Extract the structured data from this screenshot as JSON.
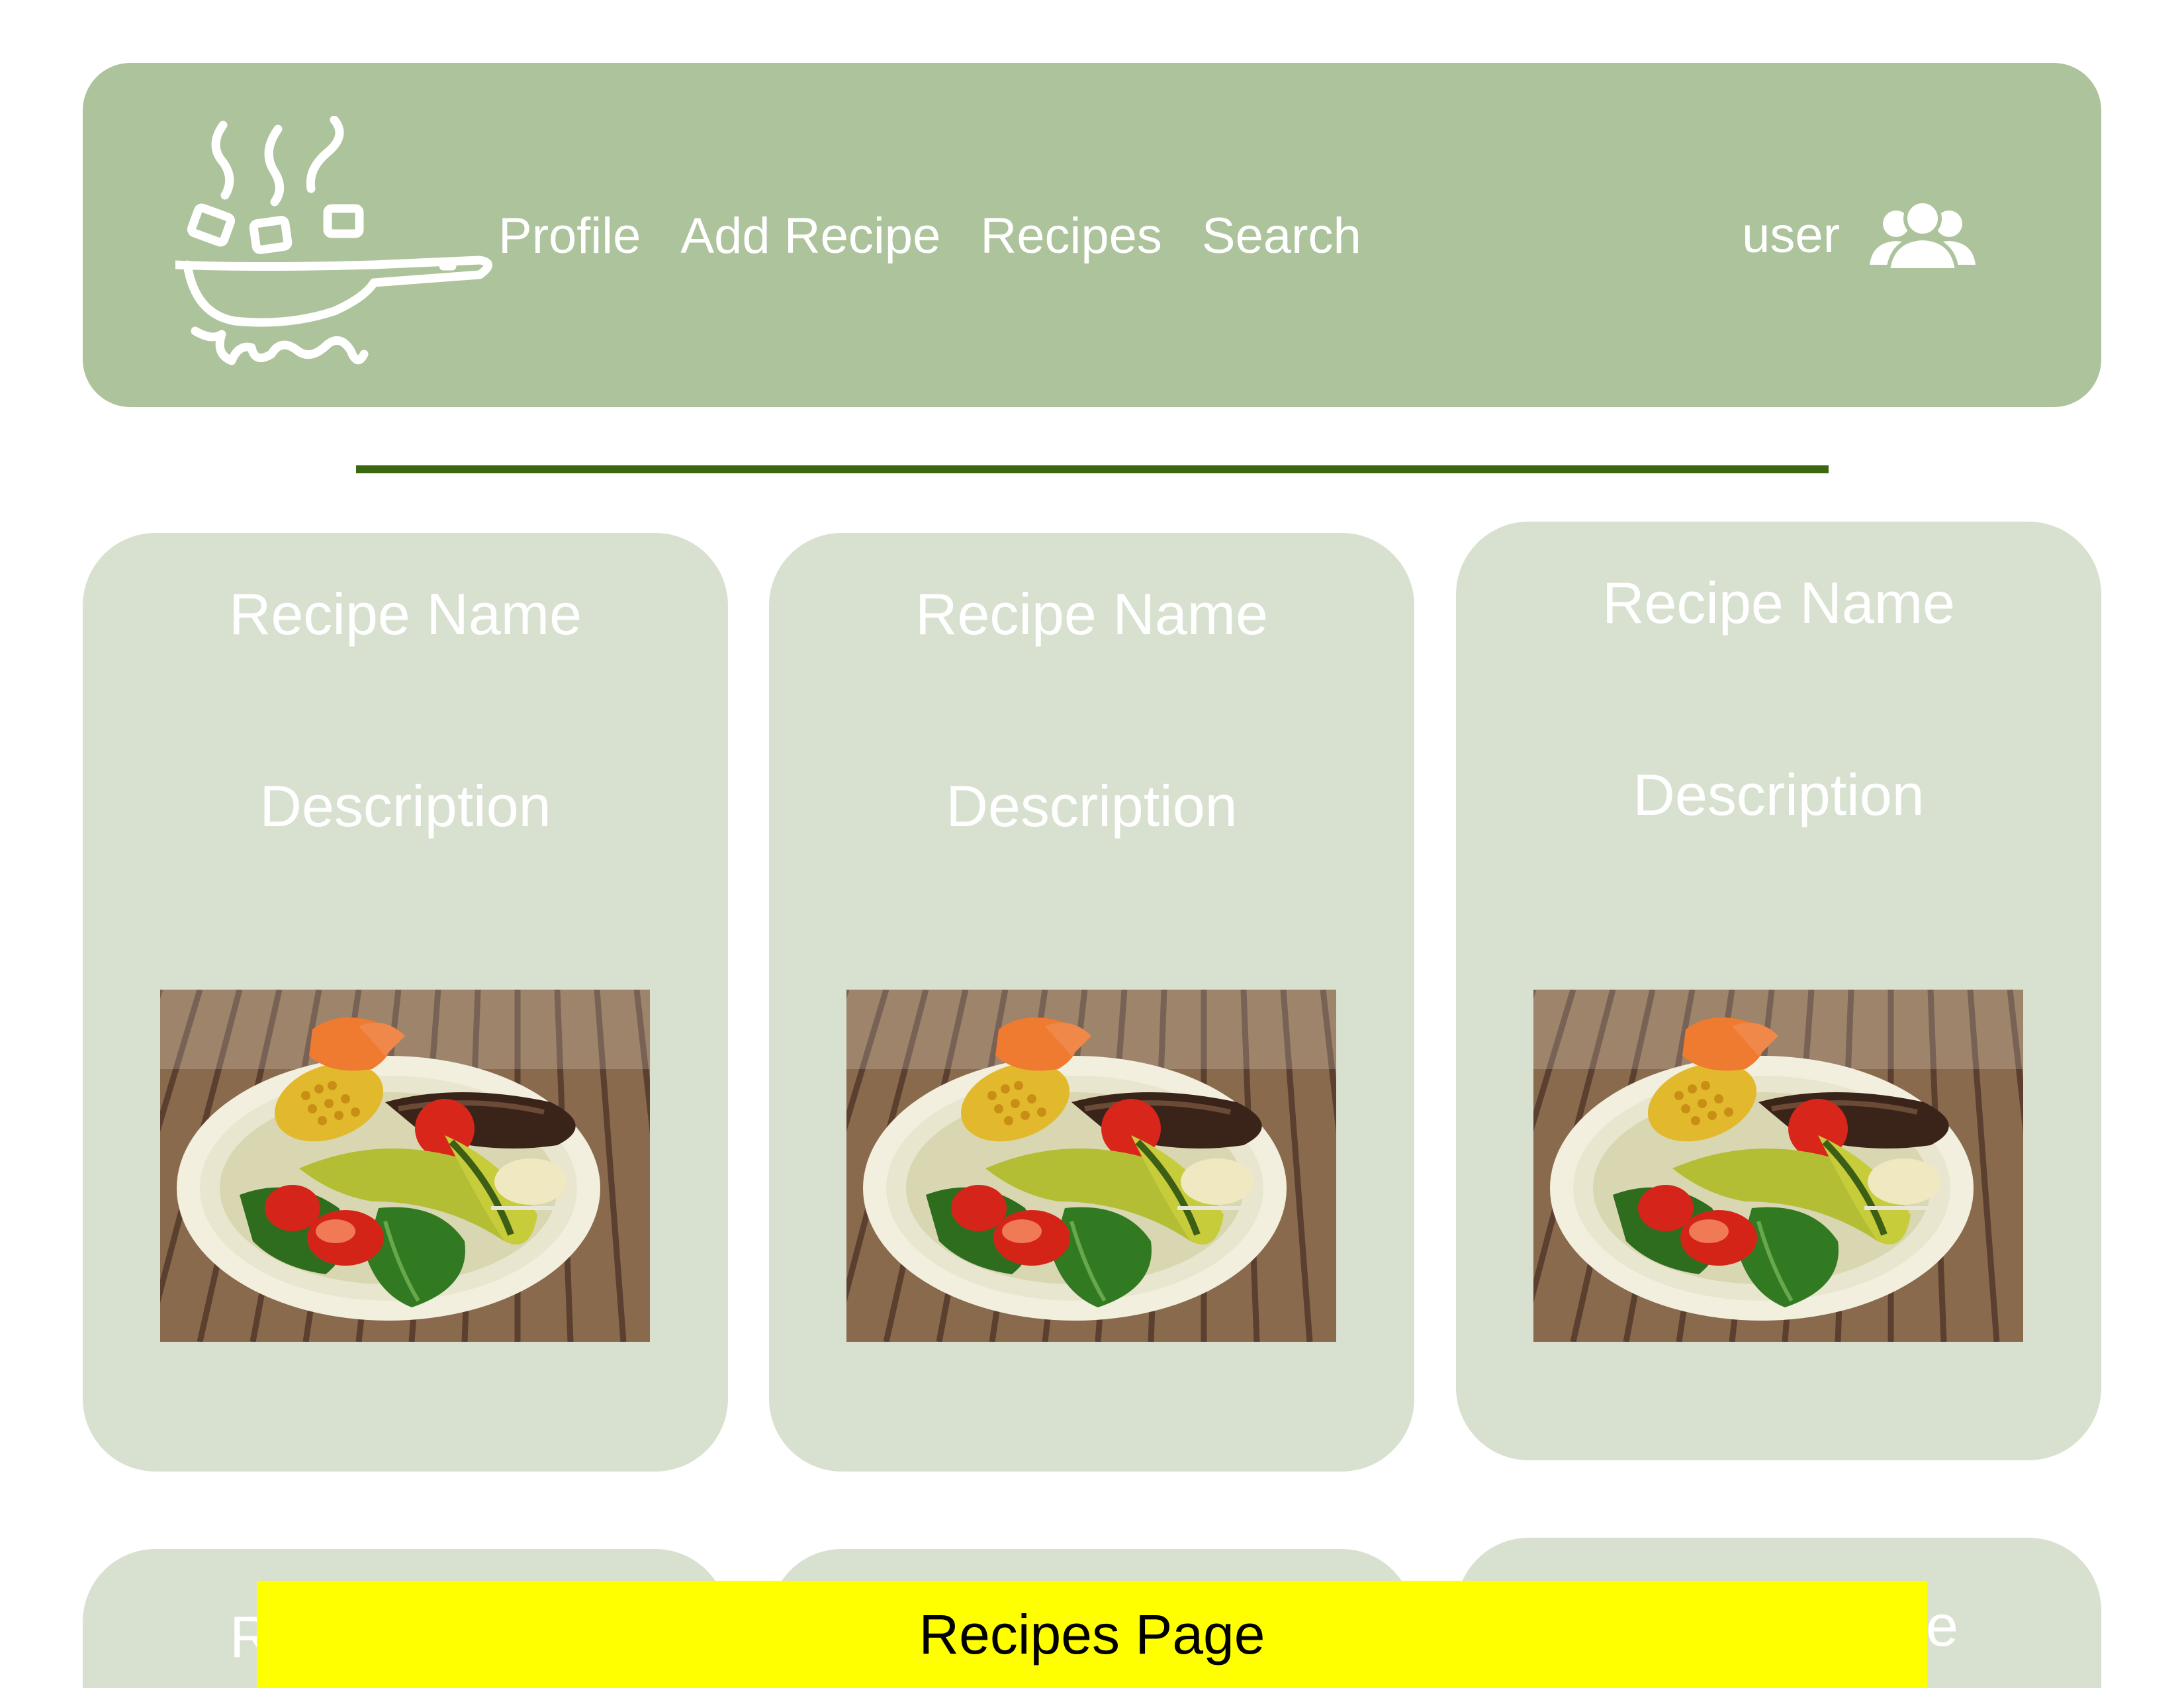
{
  "header": {
    "logo_icon": "cooking-pan-logo-icon",
    "nav": [
      {
        "label": "Profile"
      },
      {
        "label": "Add Recipe"
      },
      {
        "label": "Recipes"
      },
      {
        "label": "Search"
      }
    ],
    "user_label": "user",
    "user_icon": "users-group-icon"
  },
  "cards_row1": [
    {
      "name": "Recipe Name",
      "description": "Description",
      "image_icon": "food-plate-photo"
    },
    {
      "name": "Recipe Name",
      "description": "Description",
      "image_icon": "food-plate-photo"
    },
    {
      "name": "Recipe Name",
      "description": "Description",
      "image_icon": "food-plate-photo"
    }
  ],
  "cards_row2": [
    {
      "name_fragment": "R"
    },
    {
      "name_fragment": ""
    },
    {
      "name_fragment": "e"
    }
  ],
  "banner": {
    "text": "Recipes Page"
  },
  "colors": {
    "header_bg": "#adc39b",
    "card_bg": "#d8e1cf",
    "divider": "#3a6812",
    "banner_bg": "#ffff00"
  }
}
